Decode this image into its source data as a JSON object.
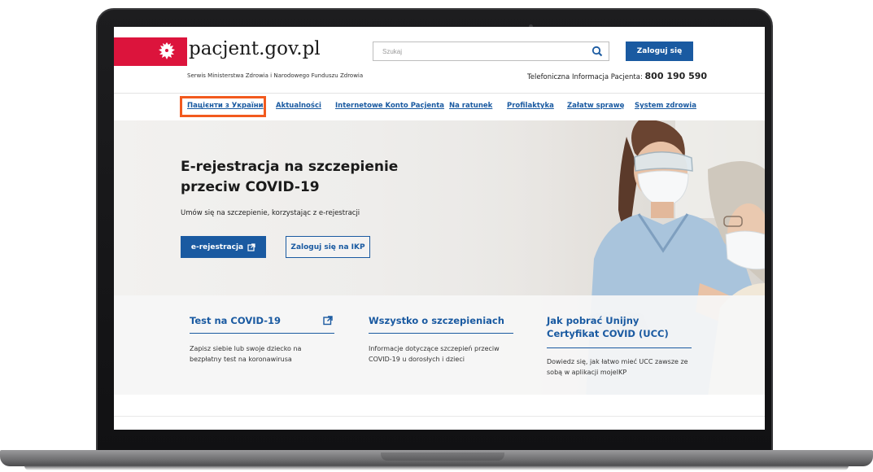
{
  "site": {
    "logo": "pacjent.gov.pl",
    "subtitle": "Serwis Ministerstwa Zdrowia i Narodowego Funduszu Zdrowia",
    "phone_label": "Telefoniczna Informacja Pacjenta:",
    "phone_number": "800 190 590"
  },
  "search": {
    "placeholder": "Szukaj",
    "value": ""
  },
  "header": {
    "login_label": "Zaloguj się"
  },
  "nav": [
    {
      "label": "Пацієнти з України",
      "highlighted": true
    },
    {
      "label": "Aktualności"
    },
    {
      "label": "Internetowe Konto Pacjenta"
    },
    {
      "label": "Na ratunek"
    },
    {
      "label": "Profilaktyka"
    },
    {
      "label": "Załatw sprawę"
    },
    {
      "label": "System zdrowia"
    }
  ],
  "hero": {
    "title": "E-rejestracja na szczepienie przeciw COVID-19",
    "subtitle": "Umów się na szczepienie, korzystając z e-rejestracji",
    "primary_button": "e-rejestracja",
    "secondary_button": "Zaloguj się na IKP"
  },
  "cards": [
    {
      "title": "Test na COVID-19",
      "text": "Zapisz siebie lub swoje dziecko na bezpłatny test na koronawirusa"
    },
    {
      "title": "Wszystko o szczepieniach",
      "text": "Informacje dotyczące szczepień przeciw COVID-19 u dorosłych i dzieci"
    },
    {
      "title": "Jak pobrać Unijny Certyfikat COVID (UCC)",
      "text": "Dowiedz się, jak łatwo mieć UCC zawsze ze sobą w aplikacji mojeIKP"
    }
  ],
  "colors": {
    "accent": "#1a5aa1",
    "flag_red": "#dc143c",
    "highlight": "#f25a1e"
  }
}
